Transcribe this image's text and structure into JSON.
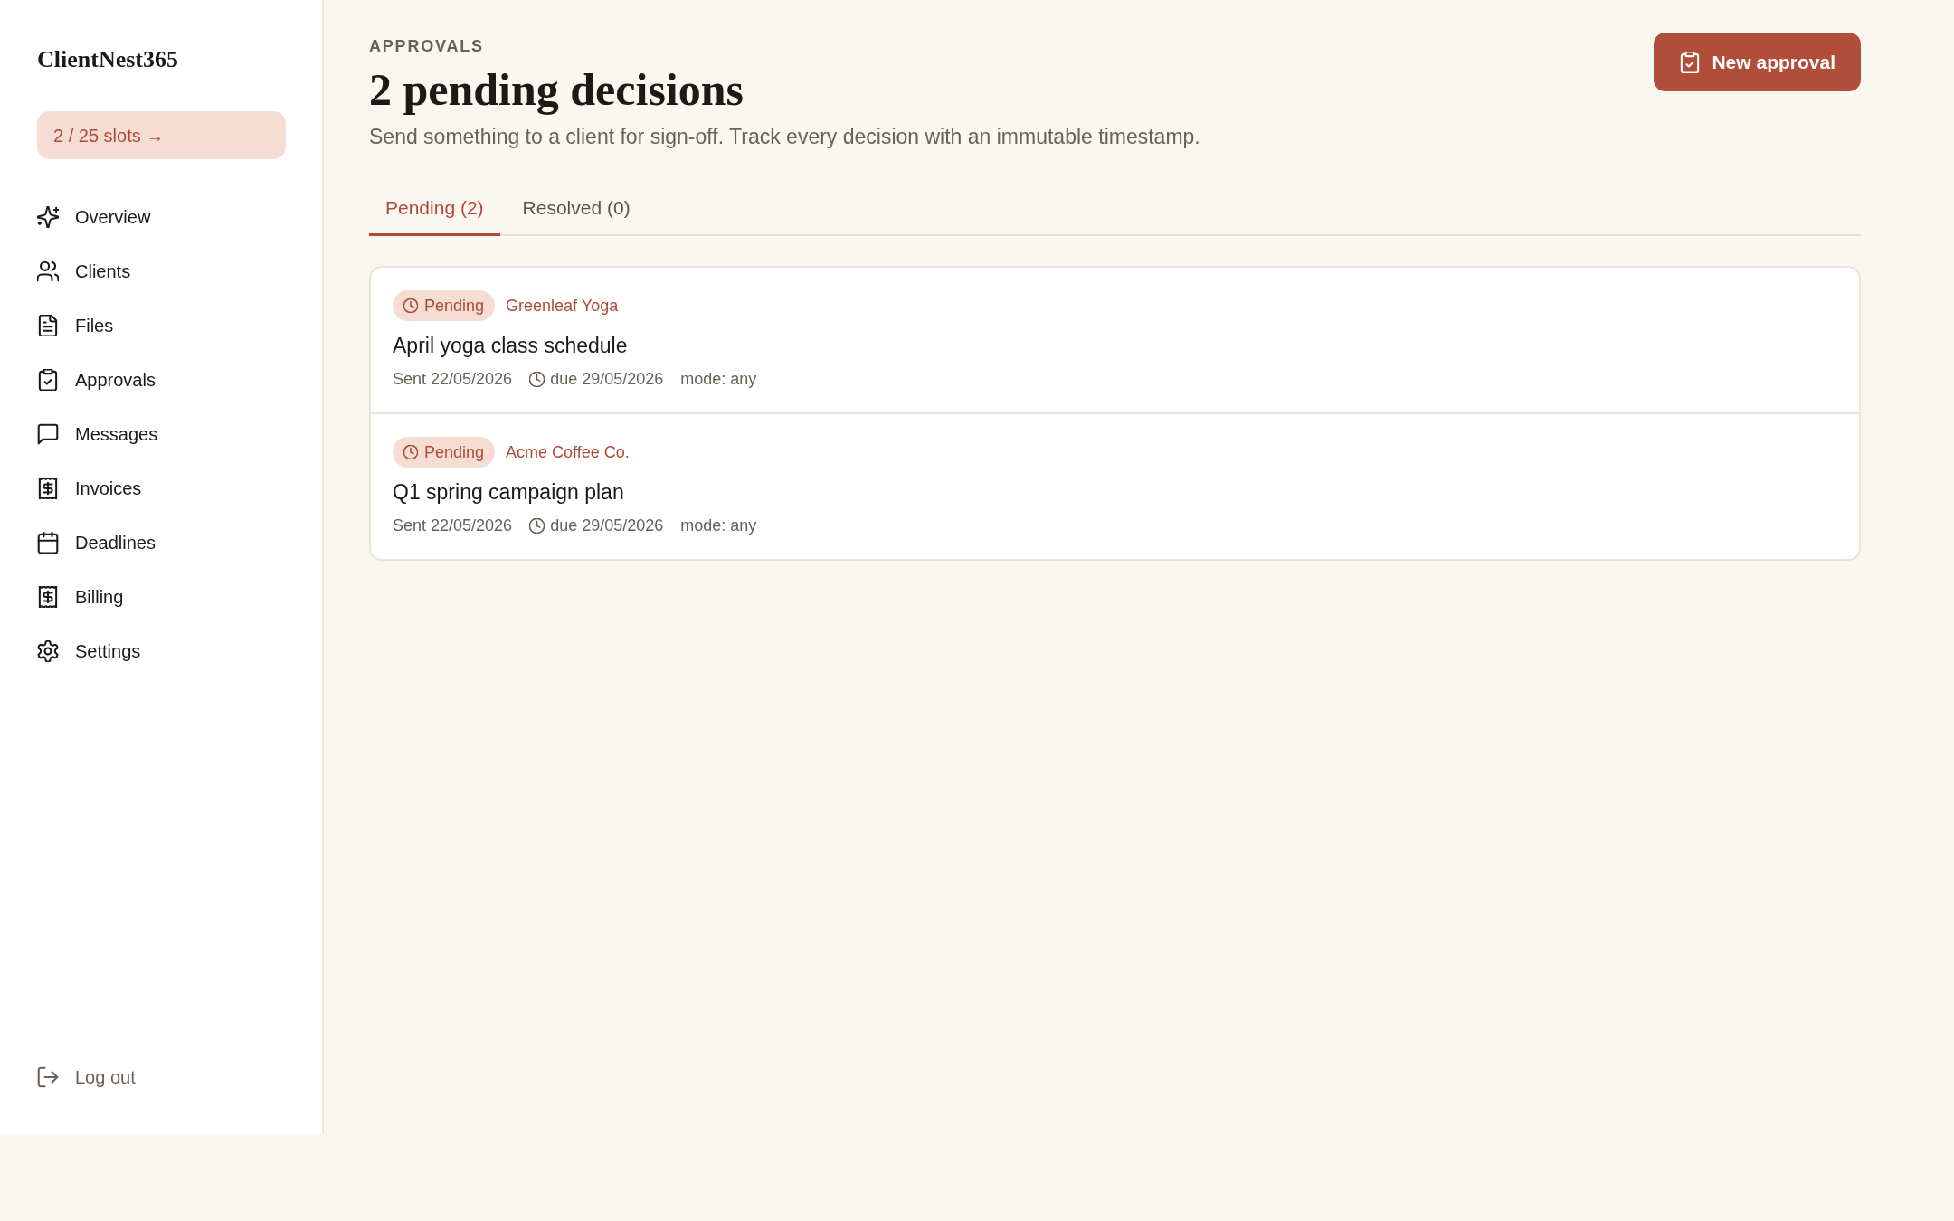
{
  "sidebar": {
    "brand": "ClientNest365",
    "slots": "2 / 25 slots →",
    "items": [
      {
        "label": "Overview",
        "selected": false
      },
      {
        "label": "Clients",
        "selected": false
      },
      {
        "label": "Files",
        "selected": false
      },
      {
        "label": "Approvals",
        "selected": false
      },
      {
        "label": "Messages",
        "selected": false
      },
      {
        "label": "Invoices",
        "selected": false
      },
      {
        "label": "Deadlines",
        "selected": false
      },
      {
        "label": "Billing",
        "selected": false
      },
      {
        "label": "Settings",
        "selected": false
      }
    ],
    "logout": "Log out"
  },
  "header": {
    "eyebrow": "APPROVALS",
    "title": "2 pending decisions",
    "subtitle": "Send something to a client for sign-off. Track every decision with an immutable timestamp.",
    "button": "New approval"
  },
  "tabs": [
    {
      "label": "Pending (2)",
      "selected": true
    },
    {
      "label": "Resolved (0)",
      "selected": false
    }
  ],
  "approvals": [
    {
      "status": "Pending",
      "client": "Greenleaf Yoga",
      "title": "April yoga class schedule",
      "sent": "Sent 22/05/2026",
      "due": "due 29/05/2026",
      "mode": "mode: any"
    },
    {
      "status": "Pending",
      "client": "Acme Coffee Co.",
      "title": "Q1 spring campaign plan",
      "sent": "Sent 22/05/2026",
      "due": "due 29/05/2026",
      "mode": "mode: any"
    }
  ]
}
